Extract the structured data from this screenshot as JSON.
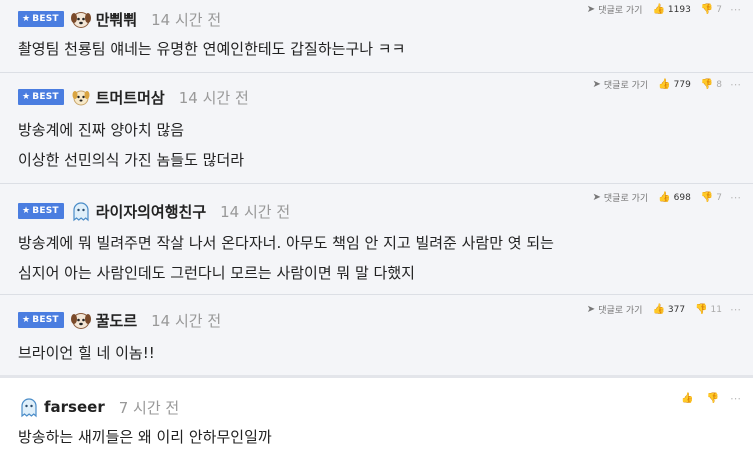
{
  "comments": [
    {
      "best": true,
      "badge": "BEST",
      "nick": "만뿨뿨",
      "time": "14 시간 전",
      "reply_label": "댓글로 가기",
      "likes": "1193",
      "dislikes": "7",
      "lines": [
        "촬영팀 천룡팀 얘네는 유명한 연예인한테도 갑질하는구나 ㅋㅋ"
      ]
    },
    {
      "best": true,
      "badge": "BEST",
      "nick": "트머트머삼",
      "time": "14 시간 전",
      "reply_label": "댓글로 가기",
      "likes": "779",
      "dislikes": "8",
      "lines": [
        "방송계에 진짜 양아치 많음",
        "이상한 선민의식 가진 놈들도 많더라"
      ]
    },
    {
      "best": true,
      "badge": "BEST",
      "nick": "라이자의여행친구",
      "time": "14 시간 전",
      "reply_label": "댓글로 가기",
      "likes": "698",
      "dislikes": "7",
      "lines": [
        "방송계에 뭐 빌려주면 작살 나서 온다자너. 아무도 책임 안 지고 빌려준 사람만 엿 되는",
        "심지어 아는 사람인데도 그런다니 모르는 사람이면 뭐 말 다했지"
      ]
    },
    {
      "best": true,
      "badge": "BEST",
      "nick": "꿀도르",
      "time": "14 시간 전",
      "reply_label": "댓글로 가기",
      "likes": "377",
      "dislikes": "11",
      "lines": [
        "브라이언 힐 네 이놈!!"
      ]
    },
    {
      "best": false,
      "nick": "farseer",
      "time": "7 시간 전",
      "lines": [
        "방송하는 새끼들은 왜 이리 안하무인일까"
      ]
    }
  ],
  "icons": {
    "reply": "reply-arrow-icon",
    "like": "thumbs-up-icon",
    "dislike": "thumbs-down-icon",
    "more": "more-dots-icon",
    "star": "star-icon"
  },
  "colors": {
    "badge": "#4a7de0",
    "best_bg": "#f4f5f8",
    "time": "#999999"
  }
}
